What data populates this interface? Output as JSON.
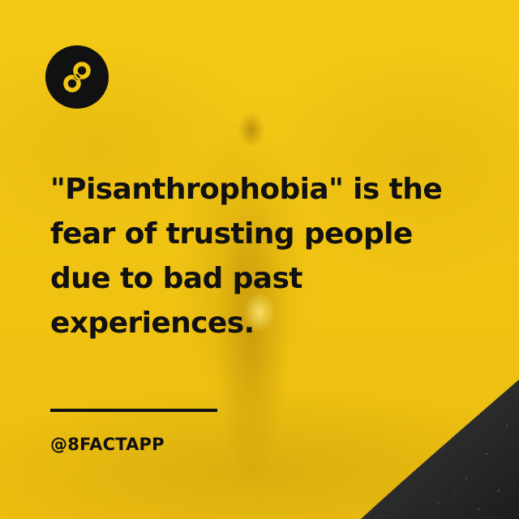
{
  "brand": {
    "logo_icon": "infinity-8-icon",
    "logo_color": "#111111"
  },
  "fact": {
    "lines": [
      "\"Pisanthrophobia\" is the",
      "fear of trusting people",
      "due to bad past",
      "experiences."
    ]
  },
  "footer": {
    "handle": "@8FACTAPP"
  },
  "colors": {
    "background": "#f2c511",
    "text": "#111111",
    "corner": "#2e2e2e"
  }
}
